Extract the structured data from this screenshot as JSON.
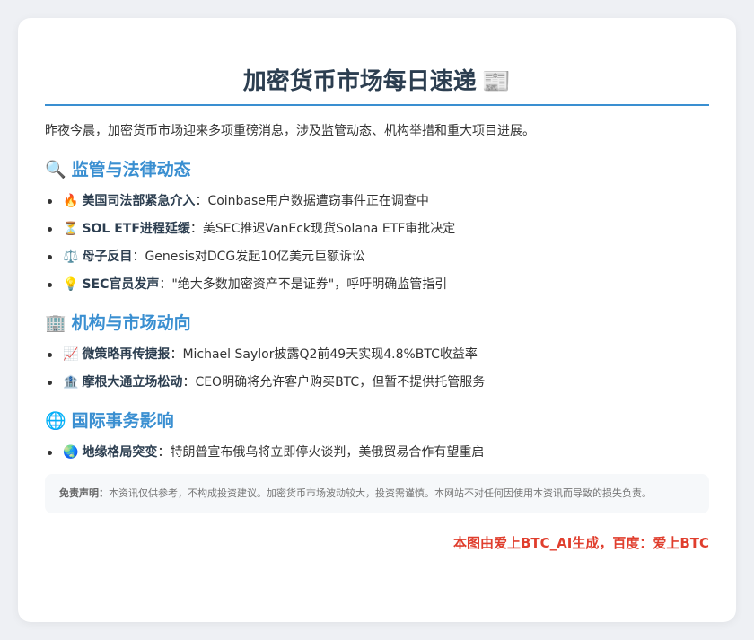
{
  "title": "加密货币市场每日速递",
  "title_icon": "📰",
  "intro": "昨夜今晨，加密货币市场迎来多项重磅消息，涉及监管动态、机构举措和重大项目进展。",
  "sections": [
    {
      "icon": "🔍",
      "heading": "监管与法律动态",
      "items": [
        {
          "icon": "🔥",
          "label": "美国司法部紧急介入",
          "sep": "：",
          "text": "Coinbase用户数据遭窃事件正在调查中"
        },
        {
          "icon": "⏳",
          "label": "SOL ETF进程延缓",
          "sep": "：",
          "text": "美SEC推迟VanEck现货Solana ETF审批决定"
        },
        {
          "icon": "⚖️",
          "label": "母子反目",
          "sep": "：",
          "text": "Genesis对DCG发起10亿美元巨额诉讼"
        },
        {
          "icon": "💡",
          "label": "SEC官员发声",
          "sep": "：",
          "text": "\"绝大多数加密资产不是证券\"，呼吁明确监管指引"
        }
      ]
    },
    {
      "icon": "🏢",
      "heading": "机构与市场动向",
      "items": [
        {
          "icon": "📈",
          "label": "微策略再传捷报",
          "sep": "：",
          "text": "Michael Saylor披露Q2前49天实现4.8%BTC收益率"
        },
        {
          "icon": "🏦",
          "label": "摩根大通立场松动",
          "sep": "：",
          "text": "CEO明确将允许客户购买BTC，但暂不提供托管服务"
        }
      ]
    },
    {
      "icon": "🌐",
      "heading": "国际事务影响",
      "items": [
        {
          "icon": "🌏",
          "label": "地缘格局突变",
          "sep": "：",
          "text": "特朗普宣布俄乌将立即停火谈判，美俄贸易合作有望重启"
        }
      ]
    }
  ],
  "disclaimer": {
    "label": "免责声明：",
    "text": "本资讯仅供参考，不构成投资建议。加密货币市场波动较大，投资需谨慎。本网站不对任何因使用本资讯而导致的损失负责。"
  },
  "footer": "本图由爱上BTC_AI生成，百度：爱上BTC"
}
